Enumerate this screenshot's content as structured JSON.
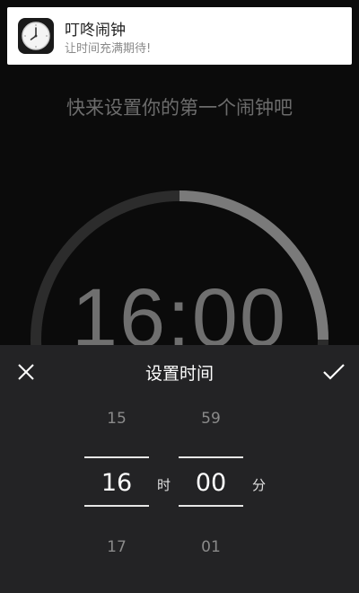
{
  "notification": {
    "title": "叮咚闹钟",
    "subtitle": "让时间充满期待!",
    "icon": "clock-icon"
  },
  "main": {
    "hint": "快来设置你的第一个闹钟吧",
    "time": "16:00",
    "dial_progress_ratio": 0.25
  },
  "picker": {
    "title": "设置时间",
    "close_icon": "close-icon",
    "confirm_icon": "check-icon",
    "hours": {
      "prev": "15",
      "current": "16",
      "next": "17",
      "unit": "时"
    },
    "minutes": {
      "prev": "59",
      "current": "00",
      "next": "01",
      "unit": "分"
    }
  },
  "colors": {
    "background": "#0b0b0b",
    "sheet": "#232325",
    "dial_track": "#2c2c2c",
    "dial_progress": "#7a7a7a"
  }
}
